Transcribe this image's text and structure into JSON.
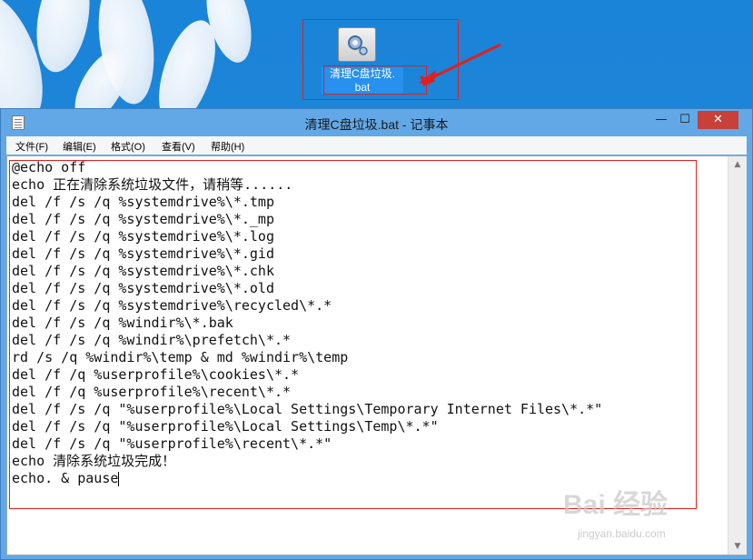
{
  "desktop": {
    "file_icon_label": "清理C盘垃圾.\nbat",
    "accent_red": "#e02020"
  },
  "window": {
    "title": "清理C盘垃圾.bat - 记事本",
    "controls": {
      "minimize": "—",
      "maximize": "☐",
      "close": "✕"
    },
    "menu": [
      "文件(F)",
      "编辑(E)",
      "格式(O)",
      "查看(V)",
      "帮助(H)"
    ]
  },
  "editor": {
    "lines": [
      "@echo off",
      "echo 正在清除系统垃圾文件，请稍等......",
      "del /f /s /q %systemdrive%\\*.tmp",
      "del /f /s /q %systemdrive%\\*._mp",
      "del /f /s /q %systemdrive%\\*.log",
      "del /f /s /q %systemdrive%\\*.gid",
      "del /f /s /q %systemdrive%\\*.chk",
      "del /f /s /q %systemdrive%\\*.old",
      "del /f /s /q %systemdrive%\\recycled\\*.*",
      "del /f /s /q %windir%\\*.bak",
      "del /f /s /q %windir%\\prefetch\\*.*",
      "rd /s /q %windir%\\temp & md %windir%\\temp",
      "del /f /q %userprofile%\\cookies\\*.*",
      "del /f /q %userprofile%\\recent\\*.*",
      "del /f /s /q \"%userprofile%\\Local Settings\\Temporary Internet Files\\*.*\"",
      "del /f /s /q \"%userprofile%\\Local Settings\\Temp\\*.*\"",
      "del /f /s /q \"%userprofile%\\recent\\*.*\"",
      "echo 清除系统垃圾完成！",
      "echo. & pause"
    ]
  },
  "watermark": {
    "brand": "Bai 经验",
    "url": "jingyan.baidu.com"
  }
}
